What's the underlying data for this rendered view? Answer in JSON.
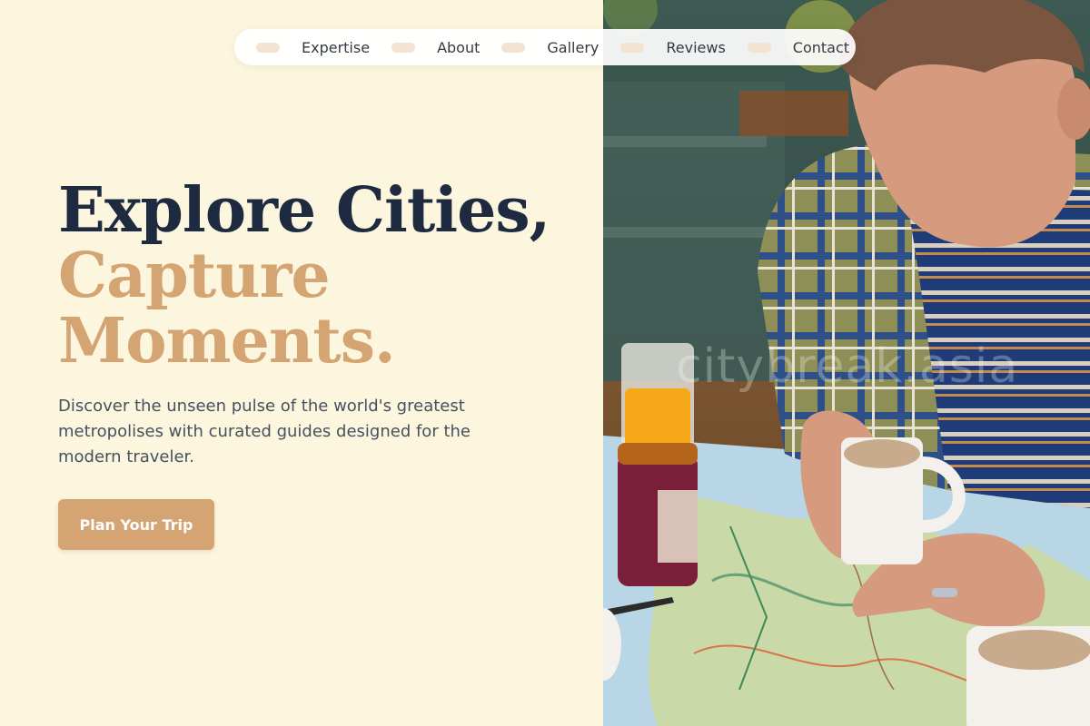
{
  "nav": {
    "items": [
      {
        "label": "Expertise"
      },
      {
        "label": "About"
      },
      {
        "label": "Gallery"
      },
      {
        "label": "Reviews"
      },
      {
        "label": "Contact"
      }
    ]
  },
  "hero": {
    "headline_line1": "Explore Cities,",
    "headline_line2": "Capture",
    "headline_line3": "Moments.",
    "subtext": "Discover the unseen pulse of the world's greatest metropolises with curated guides designed for the modern traveler.",
    "cta_label": "Plan Your Trip"
  },
  "photo": {
    "watermark": "citybreak.asia",
    "description_icon": "man-reading-map-photo"
  },
  "colors": {
    "background": "#fdf6df",
    "headline_dark": "#1d2a3f",
    "accent": "#d4a473",
    "body_text": "#46505e"
  }
}
